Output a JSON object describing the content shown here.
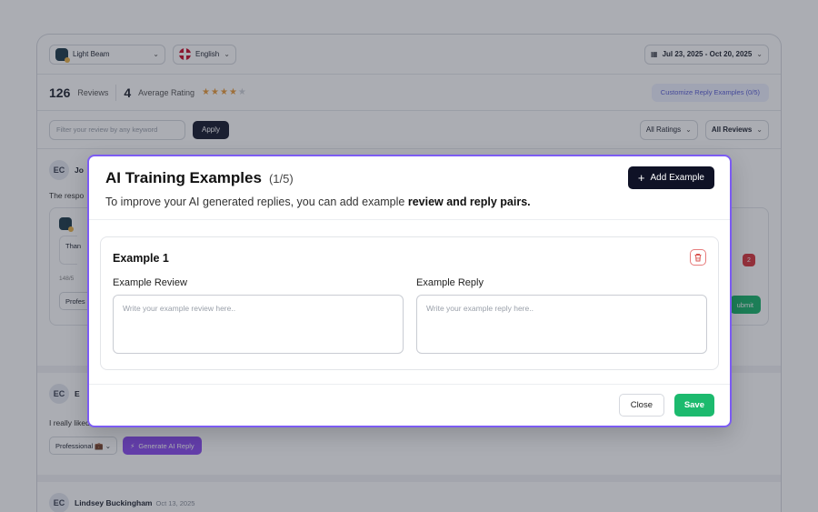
{
  "topbar": {
    "business_name": "Light Beam",
    "language": "English",
    "date_range": "Jul 23, 2025 - Oct 20, 2025"
  },
  "stats": {
    "review_count": "126",
    "reviews_label": "Reviews",
    "average_rating": "4",
    "average_label": "Average Rating",
    "stars_filled": 4,
    "stars_total": 5,
    "customize_button": "Customize Reply Examples (0/5)"
  },
  "filters": {
    "search_placeholder": "Filter your review by any keyword",
    "apply_button": "Apply",
    "ratings_select": "All Ratings",
    "reviews_select": "All Reviews"
  },
  "reviews": [
    {
      "initials": "EC",
      "name": "Jo",
      "text": "The respo",
      "reply_preview": "Than",
      "char_count": "148/5",
      "tone": "Profes",
      "submit": "ubmit",
      "badge": "2"
    },
    {
      "initials": "EC",
      "name": "E",
      "text": "I really liked it",
      "tone": "Professional 💼",
      "generate": "Generate AI Reply"
    },
    {
      "initials": "EC",
      "name": "Lindsey Buckingham",
      "date": "Oct 13, 2025"
    }
  ],
  "modal": {
    "title": "AI Training Examples",
    "count": "(1/5)",
    "subtitle_pre": "To improve your AI generated replies, you can add example ",
    "subtitle_bold": "review and reply pairs.",
    "add_button": "Add Example",
    "examples": [
      {
        "title": "Example 1",
        "review_label": "Example Review",
        "review_placeholder": "Write your example review here..",
        "reply_label": "Example Reply",
        "reply_placeholder": "Write your example reply here.."
      }
    ],
    "close_button": "Close",
    "save_button": "Save"
  },
  "colors": {
    "modal_border": "#7c5cf3",
    "save_green": "#1cba6e",
    "primary_dark": "#0f1226",
    "star": "#e89b3c"
  }
}
